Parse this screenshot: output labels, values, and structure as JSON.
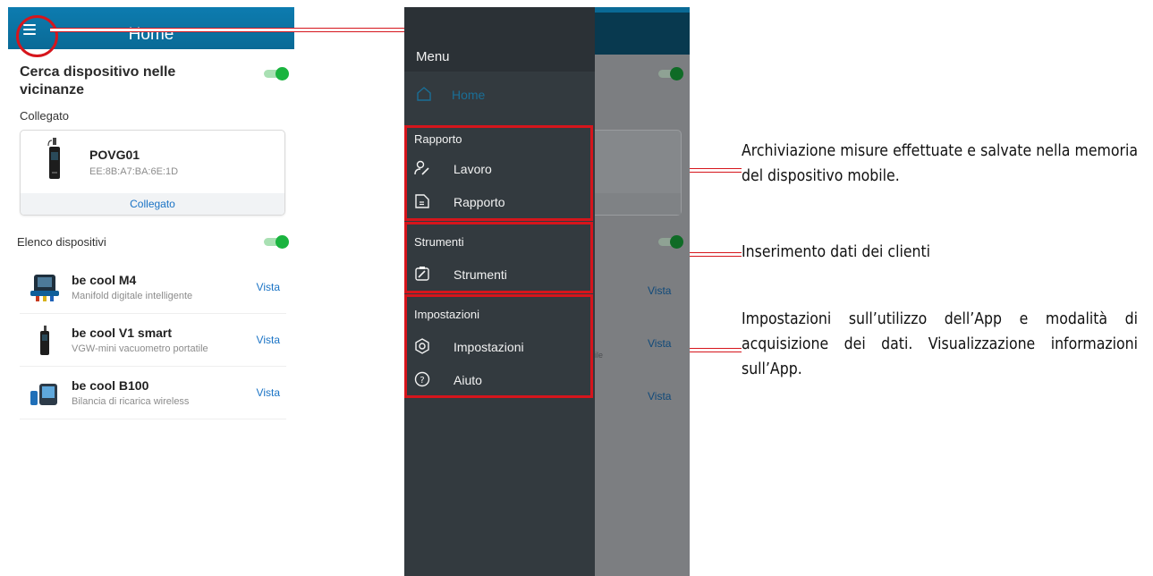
{
  "left_screen": {
    "header_title": "Home",
    "search_label": "Cerca dispositivo nelle vicinanze",
    "connected_label": "Collegato",
    "connected_device": {
      "name": "POVG01",
      "mac": "EE:8B:A7:BA:6E:1D",
      "status": "Collegato"
    },
    "device_list_label": "Elenco dispositivi",
    "devices": [
      {
        "name": "be cool M4",
        "desc": "Manifold digitale intelligente",
        "action": "Vista",
        "icon": "manifold-icon"
      },
      {
        "name": "be cool V1 smart",
        "desc": "VGW-mini vacuometro portatile",
        "action": "Vista",
        "icon": "vacuum-gauge-icon"
      },
      {
        "name": "be cool B100",
        "desc": "Bilancia di ricarica wireless",
        "action": "Vista",
        "icon": "scale-icon"
      }
    ]
  },
  "right_screen": {
    "menu_title": "Menu",
    "home_label": "Home",
    "sections": [
      {
        "title": "Rapporto",
        "items": [
          {
            "label": "Lavoro",
            "icon": "user-edit-icon"
          },
          {
            "label": "Rapporto",
            "icon": "report-icon"
          }
        ]
      },
      {
        "title": "Strumenti",
        "items": [
          {
            "label": "Strumenti",
            "icon": "tools-icon"
          }
        ]
      },
      {
        "title": "Impostazioni",
        "items": [
          {
            "label": "Impostazioni",
            "icon": "settings-icon"
          },
          {
            "label": "Aiuto",
            "icon": "help-icon"
          }
        ]
      }
    ],
    "background_vista": [
      "Vista",
      "Vista",
      "Vista"
    ],
    "background_fragment": "ile"
  },
  "annotations": [
    "Archiviazione misure effettuate e salvate nella memoria del dispositivo mobile.",
    "Inserimento dati dei clienti",
    "Impostazioni sull’utilizzo dell’App e modalità di acquisizione dei dati. Visualizzazione informazioni sull’App."
  ],
  "colors": {
    "header_blue": "#0d7cb0",
    "accent_red": "#d6151c",
    "toggle_green": "#1ab43f",
    "link_blue": "#1a73c5",
    "drawer_bg": "#333a3f"
  }
}
